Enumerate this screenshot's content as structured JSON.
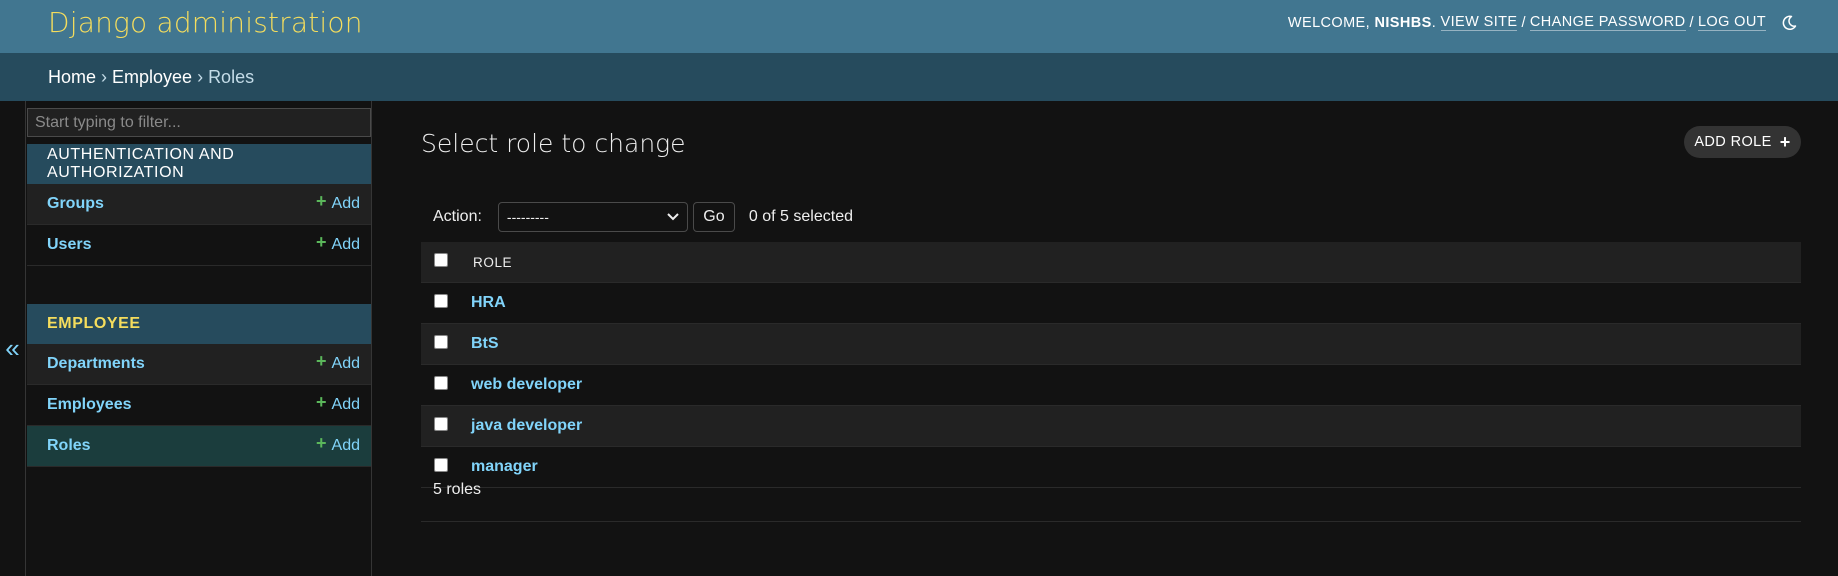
{
  "header": {
    "branding": "Django administration",
    "welcome_label": "WELCOME,",
    "username": "NISHBS",
    "view_site": "VIEW SITE",
    "change_password": "CHANGE PASSWORD",
    "log_out": "LOG OUT",
    "separator": "/",
    "theme_icon": "moon-icon"
  },
  "breadcrumbs": {
    "home": "Home",
    "app": "Employee",
    "current": "Roles",
    "arrow": "›"
  },
  "sidebar": {
    "toggle_glyph": "«",
    "filter_placeholder": "Start typing to filter...",
    "modules": [
      {
        "caption": "AUTHENTICATION AND AUTHORIZATION",
        "items": [
          {
            "label": "Groups",
            "add": "Add"
          },
          {
            "label": "Users",
            "add": "Add"
          }
        ]
      },
      {
        "caption": "EMPLOYEE",
        "items": [
          {
            "label": "Departments",
            "add": "Add"
          },
          {
            "label": "Employees",
            "add": "Add"
          },
          {
            "label": "Roles",
            "add": "Add"
          }
        ]
      }
    ]
  },
  "content": {
    "title": "Select role to change",
    "add_button": "ADD ROLE",
    "actions": {
      "label": "Action:",
      "selected_option": "---------",
      "go_label": "Go",
      "counter": "0 of 5 selected"
    },
    "table": {
      "column_header": "ROLE",
      "rows": [
        "HRA",
        "BtS",
        "web developer",
        "java developer",
        "manager"
      ]
    },
    "paginator": "5 roles"
  },
  "colors": {
    "header_bg": "#417690",
    "breadcrumb_bg": "#264b5d",
    "brand_yellow": "#f5dd5d",
    "link_blue": "#81d4fa",
    "add_green": "#5bb75b",
    "selected_row": "#1b3d3d"
  }
}
